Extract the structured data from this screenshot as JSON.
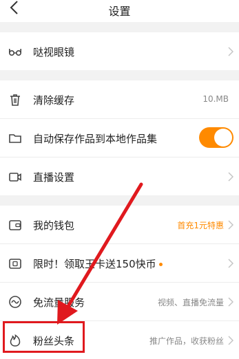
{
  "header": {
    "title": "设置"
  },
  "sections": [
    {
      "items": [
        {
          "label": "哒视眼镜",
          "value": "",
          "type": "chevron",
          "icon": "glasses-icon"
        }
      ]
    },
    {
      "items": [
        {
          "label": "清除缓存",
          "value": "10.MB",
          "type": "value",
          "icon": "trash-icon"
        },
        {
          "label": "自动保存作品到本地作品集",
          "value": "",
          "type": "toggle",
          "toggle_on": true,
          "icon": "folder-icon"
        },
        {
          "label": "直播设置",
          "value": "",
          "type": "chevron",
          "icon": "video-camera-icon"
        }
      ]
    },
    {
      "items": [
        {
          "label": "我的钱包",
          "value": "首充1元特惠",
          "type": "chevron",
          "icon": "wallet-icon"
        },
        {
          "label": "限时！领取王卡送150快币",
          "value": "",
          "type": "chevron",
          "icon": "sim-card-icon",
          "dot": true
        },
        {
          "label": "免流量服务",
          "value": "视频、直播免流量",
          "type": "chevron",
          "icon": "data-wave-icon"
        },
        {
          "label": "粉丝头条",
          "value": "推广作品，收获粉丝",
          "type": "chevron",
          "icon": "flame-icon"
        }
      ]
    }
  ],
  "colors": {
    "accent": "#ff8a00",
    "annotation": "#e0191e",
    "background": "#f2f2f2"
  }
}
